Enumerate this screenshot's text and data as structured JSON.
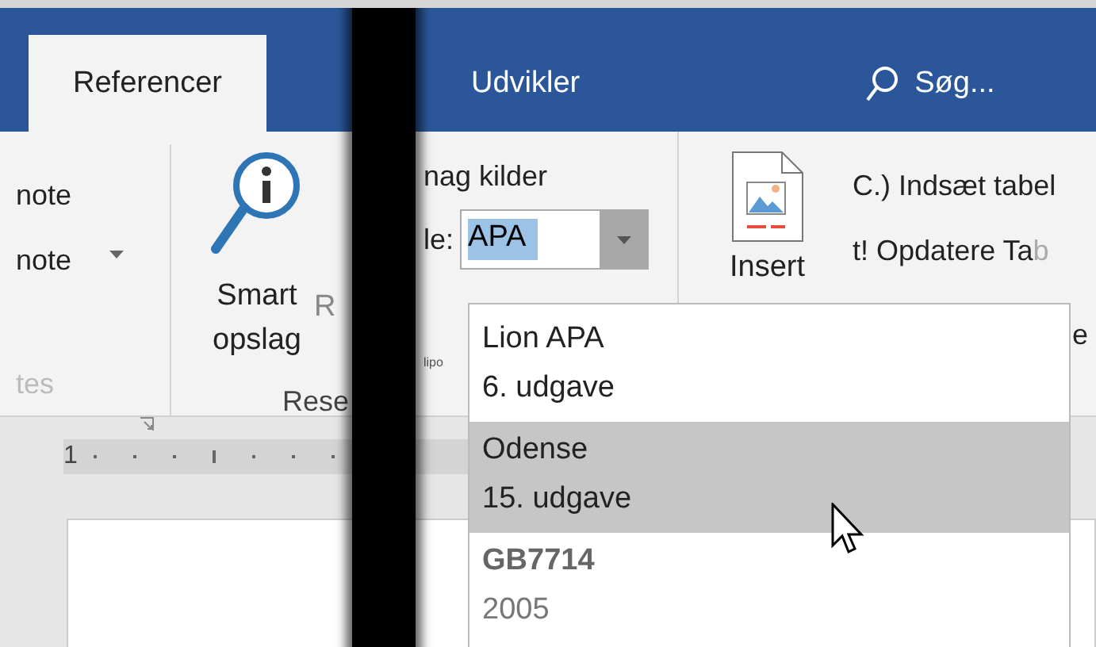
{
  "tabs": [
    {
      "label": "Referencer",
      "selected": true
    },
    {
      "label": "Udvikler",
      "selected": false
    }
  ],
  "search": {
    "placeholder": "Søg..."
  },
  "footnotes": {
    "items": [
      "note",
      "note"
    ],
    "label": "tes",
    "disabled": true
  },
  "research": {
    "button": "Smart opslag",
    "fragment": "R",
    "label": "Rese"
  },
  "citations": {
    "heading": "nag kilder",
    "style_label": "le:",
    "style_value": "APA",
    "fragment": "lipo"
  },
  "captions": {
    "button": "Insert",
    "items": [
      {
        "text": "C.) Indsæt tabel"
      },
      {
        "text": "t! Opdatere Ta",
        "tail": "b"
      }
    ],
    "fragment": "e"
  },
  "style_list": [
    {
      "name": "Lion APA",
      "edition": "6. udgave",
      "selected": false,
      "disabled": false
    },
    {
      "name": "Odense",
      "edition": "15. udgave",
      "selected": true,
      "disabled": false
    },
    {
      "name": "GB7714",
      "edition": "2005",
      "selected": false,
      "disabled": true
    }
  ],
  "ruler": {
    "label": "1"
  }
}
